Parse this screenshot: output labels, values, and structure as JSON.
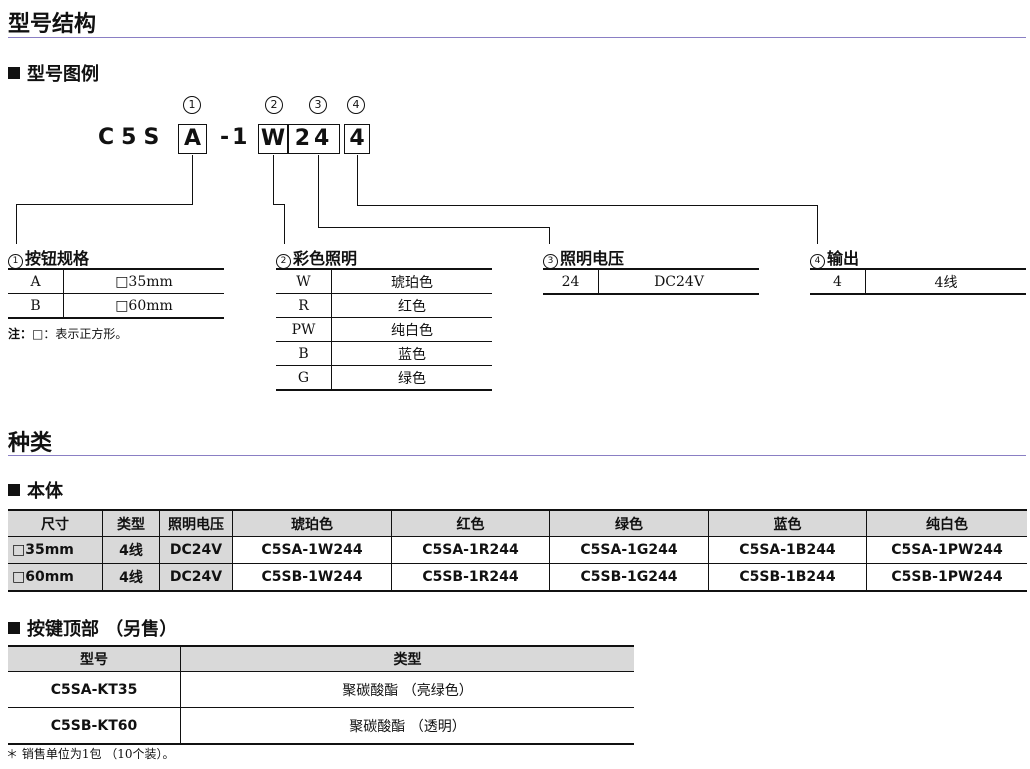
{
  "sections": {
    "model_structure": "型号结构",
    "model_legend": "型号图例",
    "types": "种类",
    "body": "本体",
    "key_tops": "按键顶部 （另售）"
  },
  "model_code": {
    "prefix": "C5S",
    "box1": "A",
    "dash": "-1",
    "box2": "W",
    "box3": "24",
    "box4": "4",
    "markers": [
      "1",
      "2",
      "3",
      "4"
    ]
  },
  "options": {
    "button_spec": {
      "num": "1",
      "title": "按钮规格",
      "rows": [
        [
          "A",
          "□35mm"
        ],
        [
          "B",
          "□60mm"
        ]
      ]
    },
    "color_light": {
      "num": "2",
      "title": "彩色照明",
      "rows": [
        [
          "W",
          "琥珀色"
        ],
        [
          "R",
          "红色"
        ],
        [
          "PW",
          "纯白色"
        ],
        [
          "B",
          "蓝色"
        ],
        [
          "G",
          "绿色"
        ]
      ]
    },
    "voltage": {
      "num": "3",
      "title": "照明电压",
      "rows": [
        [
          "24",
          "DC24V"
        ]
      ]
    },
    "output": {
      "num": "4",
      "title": "输出",
      "rows": [
        [
          "4",
          "4线"
        ]
      ]
    }
  },
  "note": {
    "label": "注：",
    "text": "□：表示正方形。"
  },
  "body_table": {
    "headers": [
      "尺寸",
      "类型",
      "照明电压",
      "琥珀色",
      "红色",
      "绿色",
      "蓝色",
      "纯白色"
    ],
    "rows": [
      [
        "□35mm",
        "4线",
        "DC24V",
        "C5SA-1W244",
        "C5SA-1R244",
        "C5SA-1G244",
        "C5SA-1B244",
        "C5SA-1PW244"
      ],
      [
        "□60mm",
        "4线",
        "DC24V",
        "C5SB-1W244",
        "C5SB-1R244",
        "C5SB-1G244",
        "C5SB-1B244",
        "C5SB-1PW244"
      ]
    ]
  },
  "tops_table": {
    "headers": [
      "型号",
      "类型"
    ],
    "rows": [
      [
        "C5SA-KT35",
        "聚碳酸酯 （亮绿色）"
      ],
      [
        "C5SB-KT60",
        "聚碳酸酯 （透明）"
      ]
    ]
  },
  "footnote": "＊ 销售单位为1包 （10个装）。"
}
